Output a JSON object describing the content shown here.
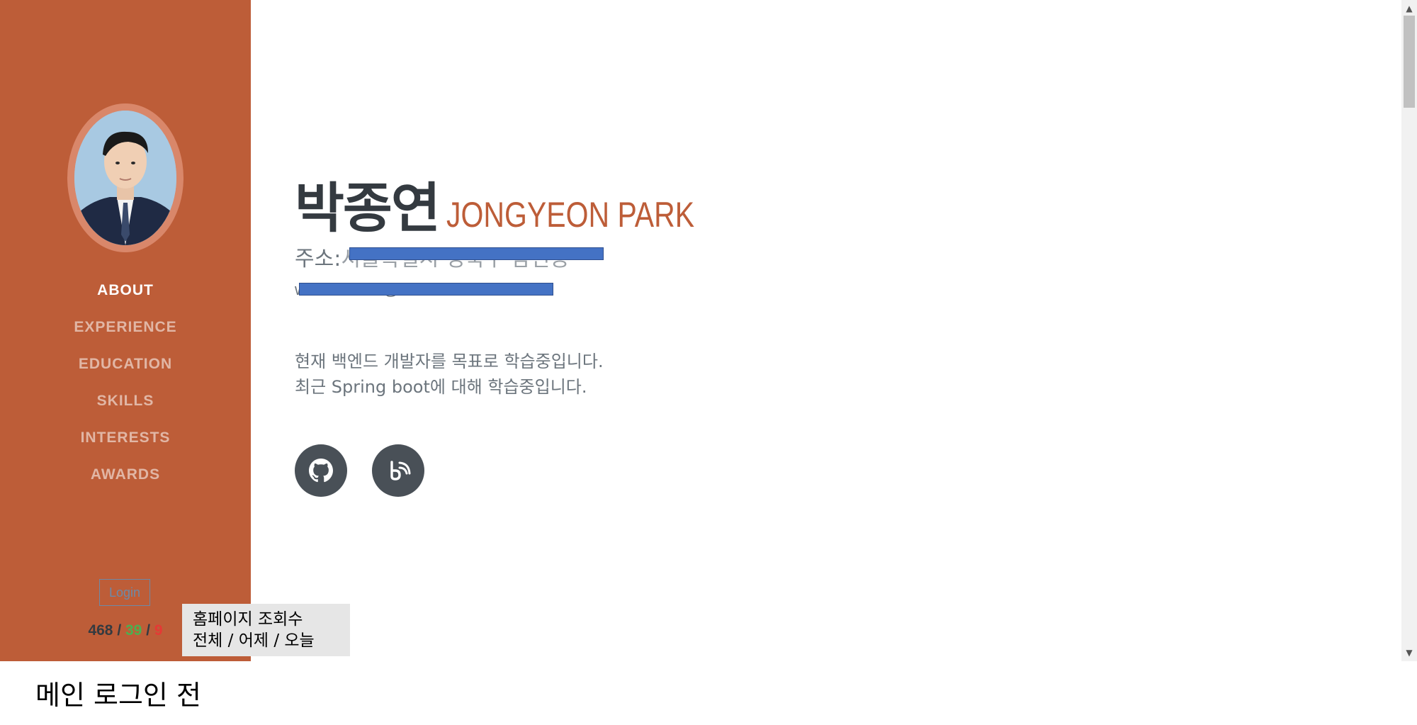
{
  "sidebar": {
    "nav": [
      {
        "label": "ABOUT",
        "active": true
      },
      {
        "label": "EXPERIENCE",
        "active": false
      },
      {
        "label": "EDUCATION",
        "active": false
      },
      {
        "label": "SKILLS",
        "active": false
      },
      {
        "label": "INTERESTS",
        "active": false
      },
      {
        "label": "AWARDS",
        "active": false
      }
    ],
    "login_label": "Login",
    "visitors": {
      "total": "468",
      "yesterday": "39",
      "today": "9",
      "separator": " / "
    },
    "accent_color": "#bd5d38"
  },
  "caption_box": {
    "line1": "홈페이지 조회수",
    "line2": "전체 / 어제 / 오늘"
  },
  "profile": {
    "name_ko": "박종연",
    "name_en": "JONGYEON PARK",
    "address_label": "주소:",
    "address_value": "서울특별시 성북구 삼선동",
    "email": "whddus5383@naver.com"
  },
  "intro": {
    "line1": "현재 백엔드 개발자를 목표로 학습중입니다.",
    "line2": "최근 Spring boot에 대해 학습중입니다."
  },
  "social": [
    {
      "icon": "github-icon"
    },
    {
      "icon": "blog-icon"
    }
  ],
  "page_caption": "메인 로그인 전"
}
